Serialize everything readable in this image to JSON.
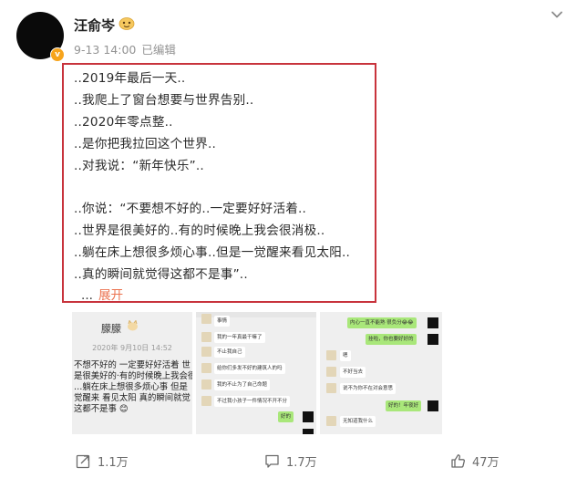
{
  "post": {
    "author": "汪俞岑",
    "time": "9-13 14:00",
    "edited": "已编辑",
    "lines": [
      "..2019年最后一天..",
      "..我爬上了窗台想要与世界告别..",
      "..2020年零点整..",
      "..是你把我拉回这个世界..",
      "..对我说：“新年快乐”..",
      "",
      "..你说：“不要想不好的..一定要好好活着..",
      "..世界是很美好的..有的时候晚上我会很消极..",
      "..躺在床上想很多烦心事..但是一觉醒来看见太阳..",
      "..真的瞬间就觉得这都不是事”.."
    ],
    "ellipsis": "...",
    "expand_label": "展开"
  },
  "images": {
    "note": {
      "name": "朦朦",
      "date": "2020年 9月10日 14:52",
      "lines": [
        "不想不好的 一定要好好活着 世",
        "是很美好的·有的时候晚上我会很",
        "…躺在床上想很多烦心事 但是",
        "觉醒来 看见太阳 真的瞬间就觉",
        "这都不是事 😊"
      ]
    },
    "chat1": {
      "bubbles": [
        "事情",
        "我的一年真最干嘛了",
        "不止我自己",
        "给你们多发不好的建筑人的吗",
        "我的不止为了自己命题",
        "不过我小孩子一件情况不开不分"
      ],
      "reply": "好的"
    },
    "chat2": {
      "green1": "内心一直不能熟 很负分😂😂",
      "green2": "挂啦，你也要好好的",
      "bubbles": [
        "嗯",
        "不好当去",
        "说不为你不在对会意思",
        "无知道我什么"
      ],
      "green3": "好的！年夜好"
    }
  },
  "actions": {
    "repost_count": "1.1万",
    "comment_count": "1.7万",
    "like_count": "47万"
  },
  "colors": {
    "highlight_border": "#c8333c",
    "expand_link": "#eb7350",
    "verified_badge": "#f7a41c",
    "meta_text": "#939393"
  },
  "icons": [
    "more-chevron-icon",
    "verified-badge-icon",
    "crown-emoji-icon",
    "repost-icon",
    "comment-icon",
    "like-icon"
  ]
}
